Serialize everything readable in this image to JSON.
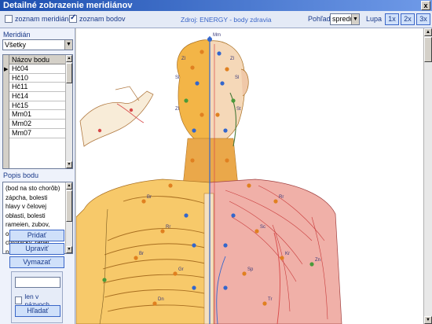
{
  "window": {
    "title": "Detailné zobrazenie meridiánov",
    "close_label": "x"
  },
  "toolbar": {
    "meridian_list_label": "zoznam meridiánov",
    "meridian_list_checked": false,
    "point_list_label": "zoznam bodov",
    "point_list_checked": true,
    "source_text": "Zdroj: ENERGY - body zdravia",
    "view_label": "Pohľad",
    "view_value": "spredu",
    "zoom_label": "Lupa",
    "zoom_buttons": [
      "1x",
      "2x",
      "3x"
    ]
  },
  "sidebar": {
    "meridian_label": "Meridián",
    "meridian_value": "Všetky",
    "points_header": "Názov bodu",
    "points": [
      "Hč04",
      "Hč10",
      "Hč11",
      "Hč14",
      "Hč15",
      "Mm01",
      "Mm02",
      "Mm07"
    ],
    "description_label": "Popis bodu",
    "description_text": "(bod na sto chorôb) zápcha, bolesti hlavy v čelovej oblasti, bolesti rameien, zubov, obrna svalov tváre, chronický zápal priedušiek, poruchy menštruačného cyklu, stavy",
    "buttons": {
      "add": "Pridať",
      "edit": "Upraviť",
      "delete": "Vymazať"
    },
    "search": {
      "input_value": "",
      "names_only_label": "len v názvoch",
      "names_only_checked": false,
      "search_button": "Hľadať"
    }
  },
  "figure": {
    "labels": [
      "Mm",
      "Zl",
      "Zl",
      "Sl",
      "Sl",
      "St",
      "Zl",
      "Br",
      "Rr",
      "Rr",
      "Sc",
      "Br",
      "Kr",
      "Gr",
      "Sp",
      "Dn",
      "Tr",
      "Zn"
    ]
  },
  "colors": {
    "accent": "#3a66c8",
    "titlebar_start": "#1d4fb0",
    "titlebar_end": "#6f9ae8",
    "skin_warm": "#f3b547",
    "muscle_red": "#d84848",
    "point_blue": "#3366cc",
    "point_orange": "#e08020"
  }
}
